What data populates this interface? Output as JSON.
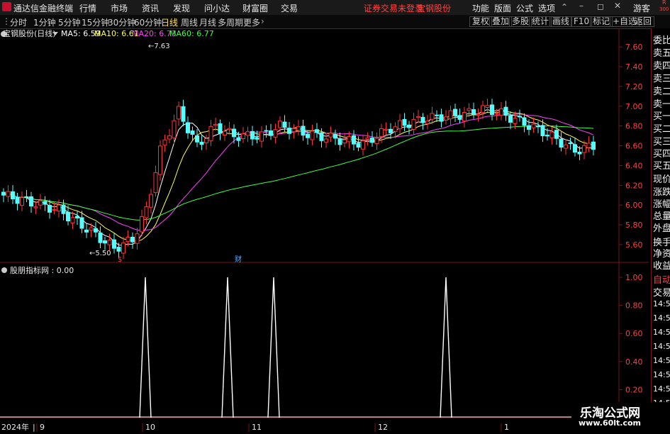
{
  "app": {
    "title": "通达信金融终端",
    "menu": [
      "行情",
      "市场",
      "资讯",
      "发现",
      "问小达",
      "财富圈",
      "交易"
    ],
    "notice": "证券交易未登录",
    "stock_title": "宝钢股份",
    "menu_right": [
      "功能",
      "版面",
      "公式",
      "选项"
    ],
    "guest": "游客",
    "corner_top": "R",
    "corner_bottom": "300"
  },
  "periods": [
    "分时",
    "1分钟",
    "5分钟",
    "15分钟",
    "30分钟",
    "60分钟",
    "日线",
    "周线",
    "月线",
    "多周期",
    "更多"
  ],
  "active_period": "日线",
  "tools": [
    "复权",
    "叠加",
    "多股",
    "统计",
    "画线",
    "F10",
    "标记",
    "+自选",
    "返回"
  ],
  "main_chart": {
    "stock_label": "宝钢股份(日线)",
    "ma": [
      {
        "name": "MA5",
        "value": "6.59",
        "color": "#ffffff"
      },
      {
        "name": "MA10",
        "value": "6.61",
        "color": "#ffff55"
      },
      {
        "name": "MA20",
        "value": "6.73",
        "color": "#ff40ff"
      },
      {
        "name": "MA60",
        "value": "6.77",
        "color": "#40ff40"
      }
    ],
    "high_label": "7.63",
    "low_label": "5.50",
    "marker_s": "$",
    "marker_cai": "财",
    "y_ticks": [
      "7.60",
      "7.40",
      "7.20",
      "7.00",
      "6.80",
      "6.60",
      "6.40",
      "6.20",
      "6.00",
      "5.80",
      "5.60"
    ],
    "up_color": "#ff3232",
    "down_color": "#54ffff"
  },
  "sub_chart": {
    "label": "股朋指标网 : 0.00",
    "y_ticks": [
      "1.00",
      "0.80",
      "0.60",
      "0.40",
      "0.20"
    ]
  },
  "x_axis": {
    "year": "2024年",
    "months": [
      "9",
      "10",
      "11",
      "12",
      "1"
    ]
  },
  "right_panel": {
    "items": [
      "委比",
      "卖五",
      "卖四",
      "卖三",
      "卖二",
      "卖一",
      "买一",
      "买二",
      "买三",
      "买四",
      "买五",
      "现价",
      "涨跌",
      "涨幅",
      "总量",
      "外盘",
      "换手",
      "净资",
      "收益"
    ],
    "sub_items": [
      "自动",
      "交易"
    ],
    "times": [
      "14:56",
      "14:56",
      "14:56",
      "14:56",
      "14:56",
      "14:56",
      "14:56",
      "14:56"
    ]
  },
  "watermark": {
    "line1": "乐淘公式网",
    "line2": "www.60lt.com"
  }
}
